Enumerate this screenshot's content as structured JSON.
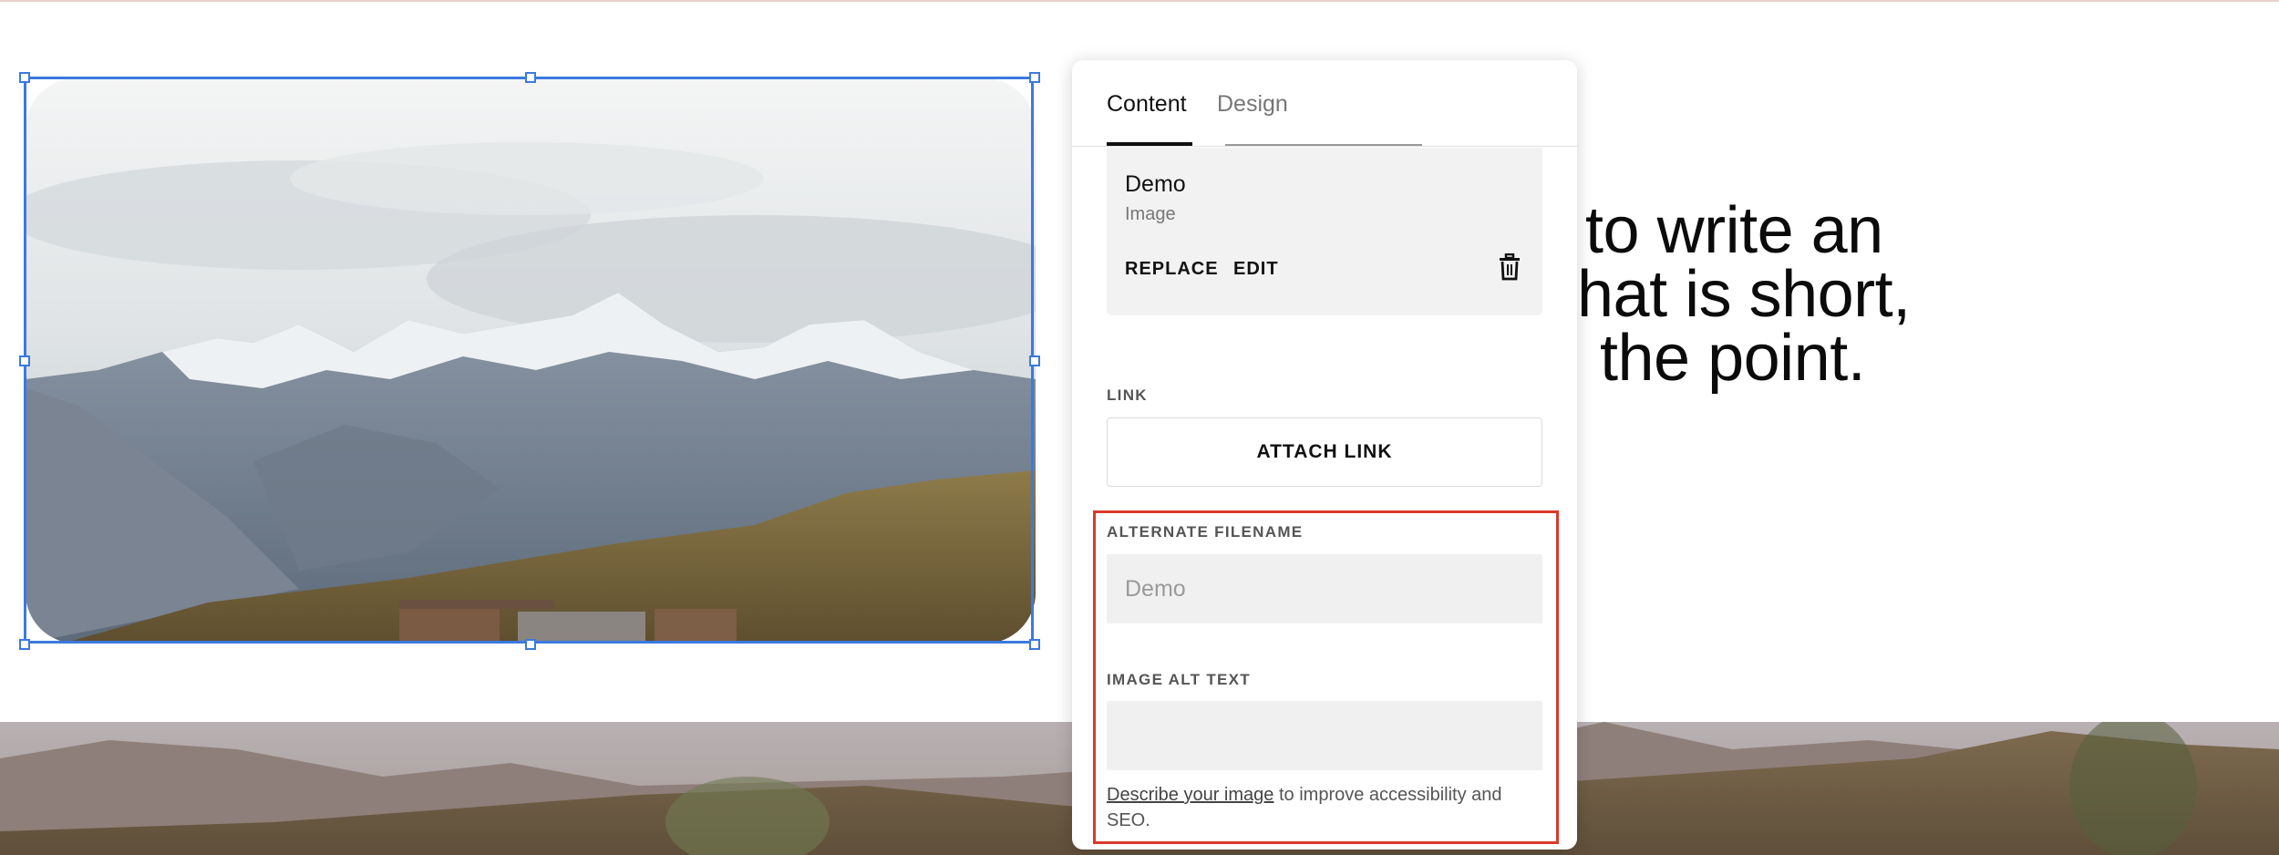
{
  "headline": {
    "line1": "e to write an",
    "line2": "hat is short,",
    "line3": "the point."
  },
  "panel": {
    "tabs": [
      {
        "label": "Content",
        "active": true
      },
      {
        "label": "Design",
        "active": false
      }
    ],
    "file": {
      "name": "Demo",
      "type": "Image",
      "replace_label": "REPLACE",
      "edit_label": "EDIT",
      "delete_icon": "trash-icon"
    },
    "link": {
      "label": "LINK",
      "button_label": "ATTACH LINK"
    },
    "alternate_filename": {
      "label": "ALTERNATE FILENAME",
      "placeholder": "Demo",
      "value": ""
    },
    "alt_text": {
      "label": "IMAGE ALT TEXT",
      "placeholder": "",
      "value": "",
      "help_link": "Describe your image",
      "help_rest": " to improve accessibility and SEO."
    }
  },
  "colors": {
    "selection": "#3b7ae0",
    "highlight": "#d93a2b",
    "input_bg": "#f0f0f0"
  }
}
